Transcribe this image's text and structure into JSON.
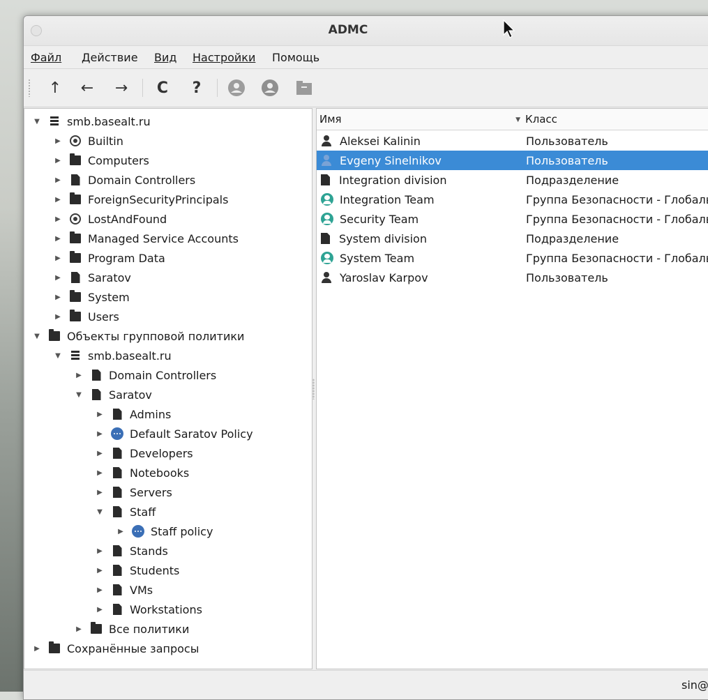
{
  "window": {
    "title": "ADMC"
  },
  "menu": [
    {
      "label": "Файл"
    },
    {
      "label": "Действие"
    },
    {
      "label": "Вид"
    },
    {
      "label": "Настройки"
    },
    {
      "label": "Помощь"
    }
  ],
  "toolbar": {
    "buttons": [
      {
        "icon": "arrow-up-icon",
        "glyph": "↑",
        "enabled": true
      },
      {
        "icon": "arrow-back-icon",
        "glyph": "←",
        "enabled": true
      },
      {
        "icon": "arrow-forward-icon",
        "glyph": "→",
        "enabled": true
      },
      {
        "icon": "refresh-icon",
        "glyph": "C",
        "enabled": true
      },
      {
        "icon": "help-icon",
        "glyph": "?",
        "enabled": true
      },
      {
        "icon": "user-circle-icon",
        "enabled": false
      },
      {
        "icon": "group-circle-icon",
        "enabled": false
      },
      {
        "icon": "ou-icon",
        "enabled": false
      }
    ]
  },
  "tree": [
    {
      "label": "smb.basealt.ru",
      "icon": "server",
      "level": 0,
      "expanded": true
    },
    {
      "label": "Builtin",
      "icon": "builtin",
      "level": 1,
      "expanded": false
    },
    {
      "label": "Computers",
      "icon": "folder",
      "level": 1,
      "expanded": false
    },
    {
      "label": "Domain Controllers",
      "icon": "ou",
      "level": 1,
      "expanded": false
    },
    {
      "label": "ForeignSecurityPrincipals",
      "icon": "folder",
      "level": 1,
      "expanded": false
    },
    {
      "label": "LostAndFound",
      "icon": "builtin",
      "level": 1,
      "expanded": false
    },
    {
      "label": "Managed Service Accounts",
      "icon": "folder",
      "level": 1,
      "expanded": false
    },
    {
      "label": "Program Data",
      "icon": "folder",
      "level": 1,
      "expanded": false
    },
    {
      "label": "Saratov",
      "icon": "ou",
      "level": 1,
      "expanded": false
    },
    {
      "label": "System",
      "icon": "folder",
      "level": 1,
      "expanded": false
    },
    {
      "label": "Users",
      "icon": "folder",
      "level": 1,
      "expanded": false
    },
    {
      "label": "Объекты групповой политики",
      "icon": "folder",
      "level": 0,
      "expanded": true
    },
    {
      "label": "smb.basealt.ru",
      "icon": "server",
      "level": 1,
      "expanded": true
    },
    {
      "label": "Domain Controllers",
      "icon": "ou",
      "level": 2,
      "expanded": false
    },
    {
      "label": "Saratov",
      "icon": "ou",
      "level": 2,
      "expanded": true
    },
    {
      "label": "Admins",
      "icon": "ou",
      "level": 3,
      "expanded": false
    },
    {
      "label": "Default Saratov Policy",
      "icon": "policy",
      "level": 3,
      "expanded": false
    },
    {
      "label": "Developers",
      "icon": "ou",
      "level": 3,
      "expanded": false
    },
    {
      "label": "Notebooks",
      "icon": "ou",
      "level": 3,
      "expanded": false
    },
    {
      "label": "Servers",
      "icon": "ou",
      "level": 3,
      "expanded": false
    },
    {
      "label": "Staff",
      "icon": "ou",
      "level": 3,
      "expanded": true
    },
    {
      "label": "Staff policy",
      "icon": "policy",
      "level": 4,
      "expanded": false
    },
    {
      "label": "Stands",
      "icon": "ou",
      "level": 3,
      "expanded": false
    },
    {
      "label": "Students",
      "icon": "ou",
      "level": 3,
      "expanded": false
    },
    {
      "label": "VMs",
      "icon": "ou",
      "level": 3,
      "expanded": false
    },
    {
      "label": "Workstations",
      "icon": "ou",
      "level": 3,
      "expanded": false
    },
    {
      "label": "Все политики",
      "icon": "folder",
      "level": 2,
      "expanded": false
    },
    {
      "label": "Сохранённые запросы",
      "icon": "folder",
      "level": 0,
      "expanded": false
    }
  ],
  "list": {
    "columns": [
      "Имя",
      "Класс"
    ],
    "rows": [
      {
        "name": "Aleksei Kalinin",
        "class": "Пользователь",
        "icon": "user",
        "selected": false
      },
      {
        "name": "Evgeny Sinelnikov",
        "class": "Пользователь",
        "icon": "user",
        "selected": true
      },
      {
        "name": "Integration division",
        "class": "Подразделение",
        "icon": "ou",
        "selected": false
      },
      {
        "name": "Integration Team",
        "class": "Группа Безопасности - Глобаль",
        "icon": "group",
        "selected": false
      },
      {
        "name": "Security Team",
        "class": "Группа Безопасности - Глобаль",
        "icon": "group",
        "selected": false
      },
      {
        "name": "System division",
        "class": "Подразделение",
        "icon": "ou",
        "selected": false
      },
      {
        "name": "System Team",
        "class": "Группа Безопасности - Глобаль",
        "icon": "group",
        "selected": false
      },
      {
        "name": "Yaroslav Karpov",
        "class": "Пользователь",
        "icon": "user",
        "selected": false
      }
    ]
  },
  "status": {
    "text": "sin@"
  },
  "colors": {
    "selection": "#3b8bd6",
    "group": "#2ea394",
    "policy": "#3b6fb6"
  }
}
